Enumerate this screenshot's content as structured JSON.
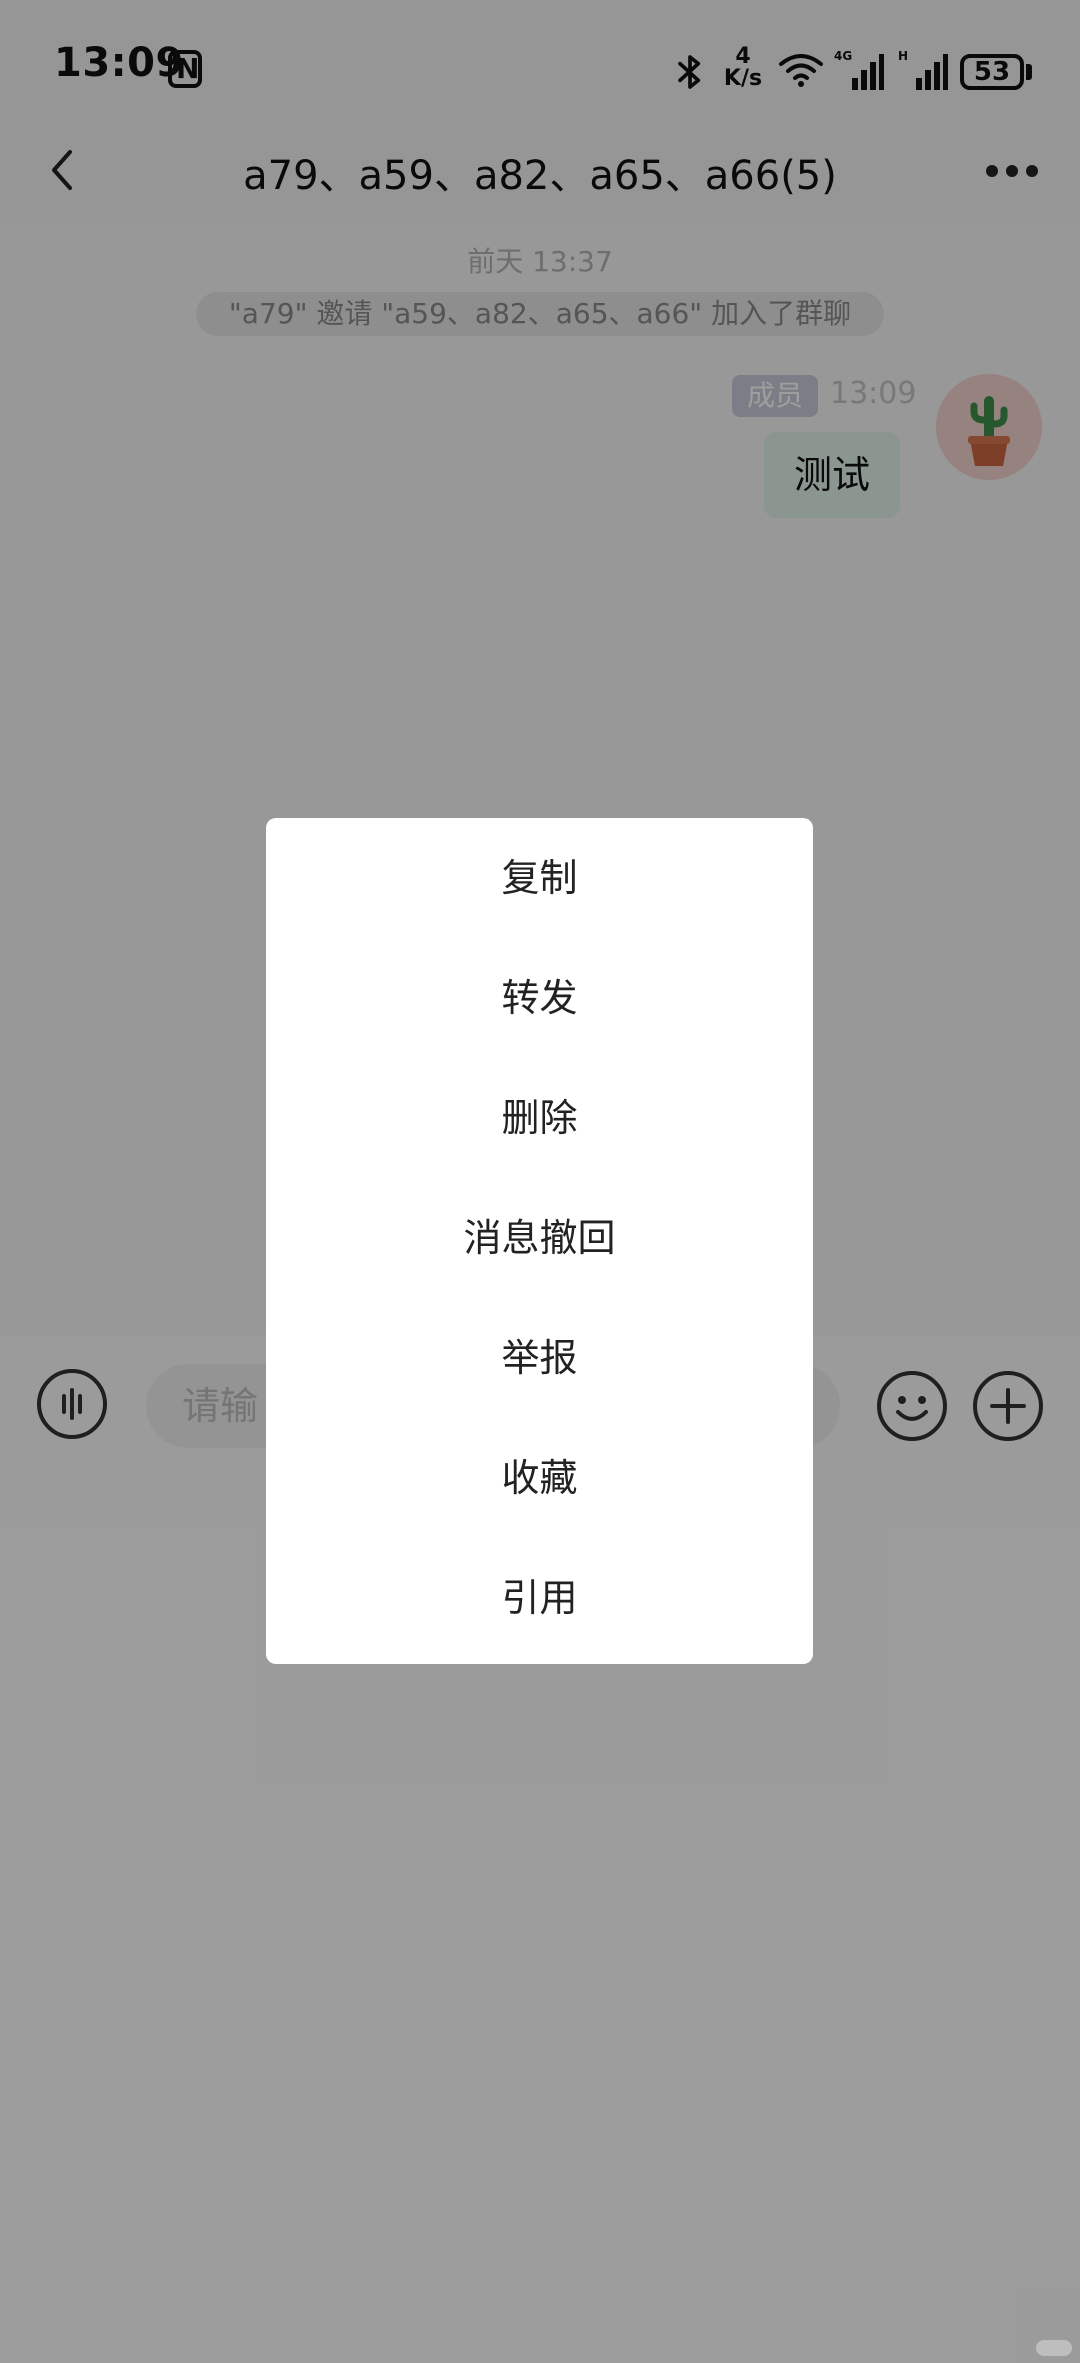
{
  "status_bar": {
    "time": "13:09",
    "network_speed": "4\nK/s",
    "battery": "53",
    "icons": [
      "nfc-icon",
      "bluetooth-icon",
      "wifi-icon",
      "signal-4g-icon",
      "signal-hd-icon",
      "battery-icon"
    ]
  },
  "header": {
    "title": "a79、a59、a82、a65、a66(5)",
    "icons": [
      "back-arrow-icon",
      "more-icon"
    ]
  },
  "chat": {
    "timestamp": "前天 13:37",
    "system_notice": "\"a79\" 邀请 \"a59、a82、a65、a66\" 加入了群聊",
    "message": {
      "badge": "成员",
      "time": "13:09",
      "text": "测试",
      "avatar_icon": "cactus-avatar-icon"
    }
  },
  "input_bar": {
    "placeholder": "请输",
    "icons": [
      "voice-icon",
      "emoji-icon",
      "plus-icon"
    ]
  },
  "context_menu": {
    "items": [
      {
        "label": "复制"
      },
      {
        "label": "转发"
      },
      {
        "label": "删除"
      },
      {
        "label": "消息撤回"
      },
      {
        "label": "举报"
      },
      {
        "label": "收藏"
      },
      {
        "label": "引用"
      }
    ]
  }
}
